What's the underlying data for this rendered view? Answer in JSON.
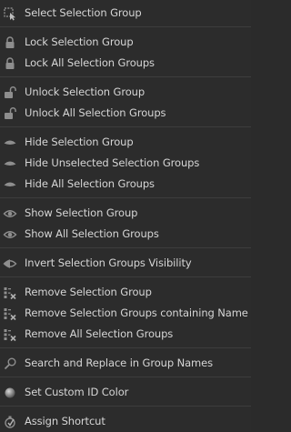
{
  "menu": {
    "items": [
      {
        "key": "select",
        "label": "Select Selection Group",
        "icon": "select-icon"
      },
      {
        "key": "lock",
        "label": "Lock Selection Group",
        "icon": "lock-icon"
      },
      {
        "key": "lock_all",
        "label": "Lock All Selection Groups",
        "icon": "lock-icon"
      },
      {
        "key": "unlock",
        "label": "Unlock Selection Group",
        "icon": "unlock-icon"
      },
      {
        "key": "unlock_all",
        "label": "Unlock All Selection Groups",
        "icon": "unlock-icon"
      },
      {
        "key": "hide",
        "label": "Hide Selection Group",
        "icon": "eye-closed-icon"
      },
      {
        "key": "hide_unselected",
        "label": "Hide Unselected Selection Groups",
        "icon": "eye-closed-icon"
      },
      {
        "key": "hide_all",
        "label": "Hide All Selection Groups",
        "icon": "eye-closed-icon"
      },
      {
        "key": "show",
        "label": "Show Selection Group",
        "icon": "eye-open-icon"
      },
      {
        "key": "show_all",
        "label": "Show All Selection Groups",
        "icon": "eye-open-icon"
      },
      {
        "key": "invert",
        "label": "Invert Selection Groups Visibility",
        "icon": "eye-invert-icon"
      },
      {
        "key": "remove",
        "label": "Remove Selection Group",
        "icon": "list-remove-icon"
      },
      {
        "key": "remove_containing",
        "label": "Remove Selection Groups containing Name",
        "icon": "list-remove-icon"
      },
      {
        "key": "remove_all",
        "label": "Remove All Selection Groups",
        "icon": "list-remove-icon"
      },
      {
        "key": "search_replace",
        "label": "Search and Replace in Group Names",
        "icon": "search-icon"
      },
      {
        "key": "custom_color",
        "label": "Set Custom ID Color",
        "icon": "color-sphere-icon"
      },
      {
        "key": "shortcut",
        "label": "Assign Shortcut",
        "icon": "shortcut-icon"
      }
    ]
  },
  "colors": {
    "background": "#2c2c2c",
    "text": "#d6d6d6",
    "icon": "#9a9a9a",
    "separator": "#3d3d3d"
  }
}
